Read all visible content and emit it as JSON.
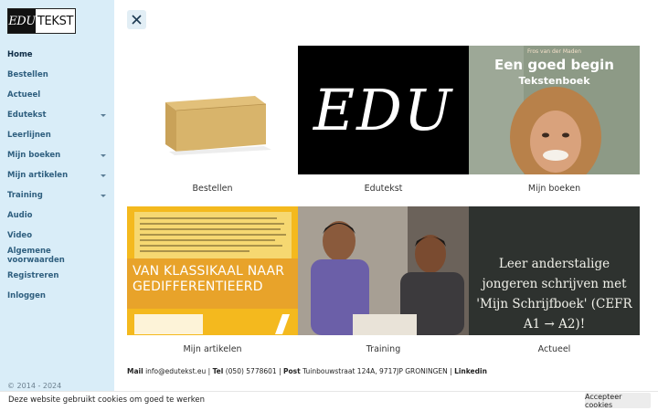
{
  "logo": {
    "left": "EDU",
    "right": "TEKST"
  },
  "sidebar": {
    "items": [
      {
        "label": "Home",
        "has_submenu": false,
        "active": true
      },
      {
        "label": "Bestellen",
        "has_submenu": false
      },
      {
        "label": "Actueel",
        "has_submenu": false
      },
      {
        "label": "Edutekst",
        "has_submenu": true
      },
      {
        "label": "Leerlijnen",
        "has_submenu": false
      },
      {
        "label": "Mijn boeken",
        "has_submenu": true
      },
      {
        "label": "Mijn artikelen",
        "has_submenu": true
      },
      {
        "label": "Training",
        "has_submenu": true
      },
      {
        "label": "Audio",
        "has_submenu": false
      },
      {
        "label": "Video",
        "has_submenu": false
      },
      {
        "label": "Algemene voorwaarden",
        "has_submenu": false
      },
      {
        "label": "Registreren",
        "has_submenu": false
      },
      {
        "label": "Inloggen",
        "has_submenu": false
      }
    ],
    "copyright": "© 2014 - 2024"
  },
  "close_button": {
    "icon": "close-icon"
  },
  "tiles": [
    {
      "caption": "Bestellen"
    },
    {
      "caption": "Edutekst",
      "image_text": "EDU"
    },
    {
      "caption": "Mijn boeken",
      "author": "Fros van der Maden",
      "title": "Een goed begin",
      "subtitle": "Tekstenboek"
    },
    {
      "caption": "Mijn artikelen",
      "image_title": "VAN KLASSIKAAL NAAR GEDIFFERENTIEERD"
    },
    {
      "caption": "Training"
    },
    {
      "caption": "Actueel",
      "image_text": "Leer anderstalige jongeren schrijven met 'Mijn Schrijfboek' (CEFR A1 → A2)!"
    }
  ],
  "contact": {
    "mail_label": "Mail",
    "mail": "info@edutekst.eu",
    "tel_label": "Tel",
    "tel": "(050) 5778601",
    "post_label": "Post",
    "post": "Tuinbouwstraat 124A,  9717JP GRONINGEN",
    "linkedin": "Linkedin"
  },
  "cookie": {
    "text": "Deze website gebruikt cookies om goed te werken",
    "button": "Accepteer cookies"
  },
  "colors": {
    "sidebar_bg": "#d9edf8",
    "nav_text": "#2f5f7f",
    "close_bg": "#e2eef5"
  }
}
